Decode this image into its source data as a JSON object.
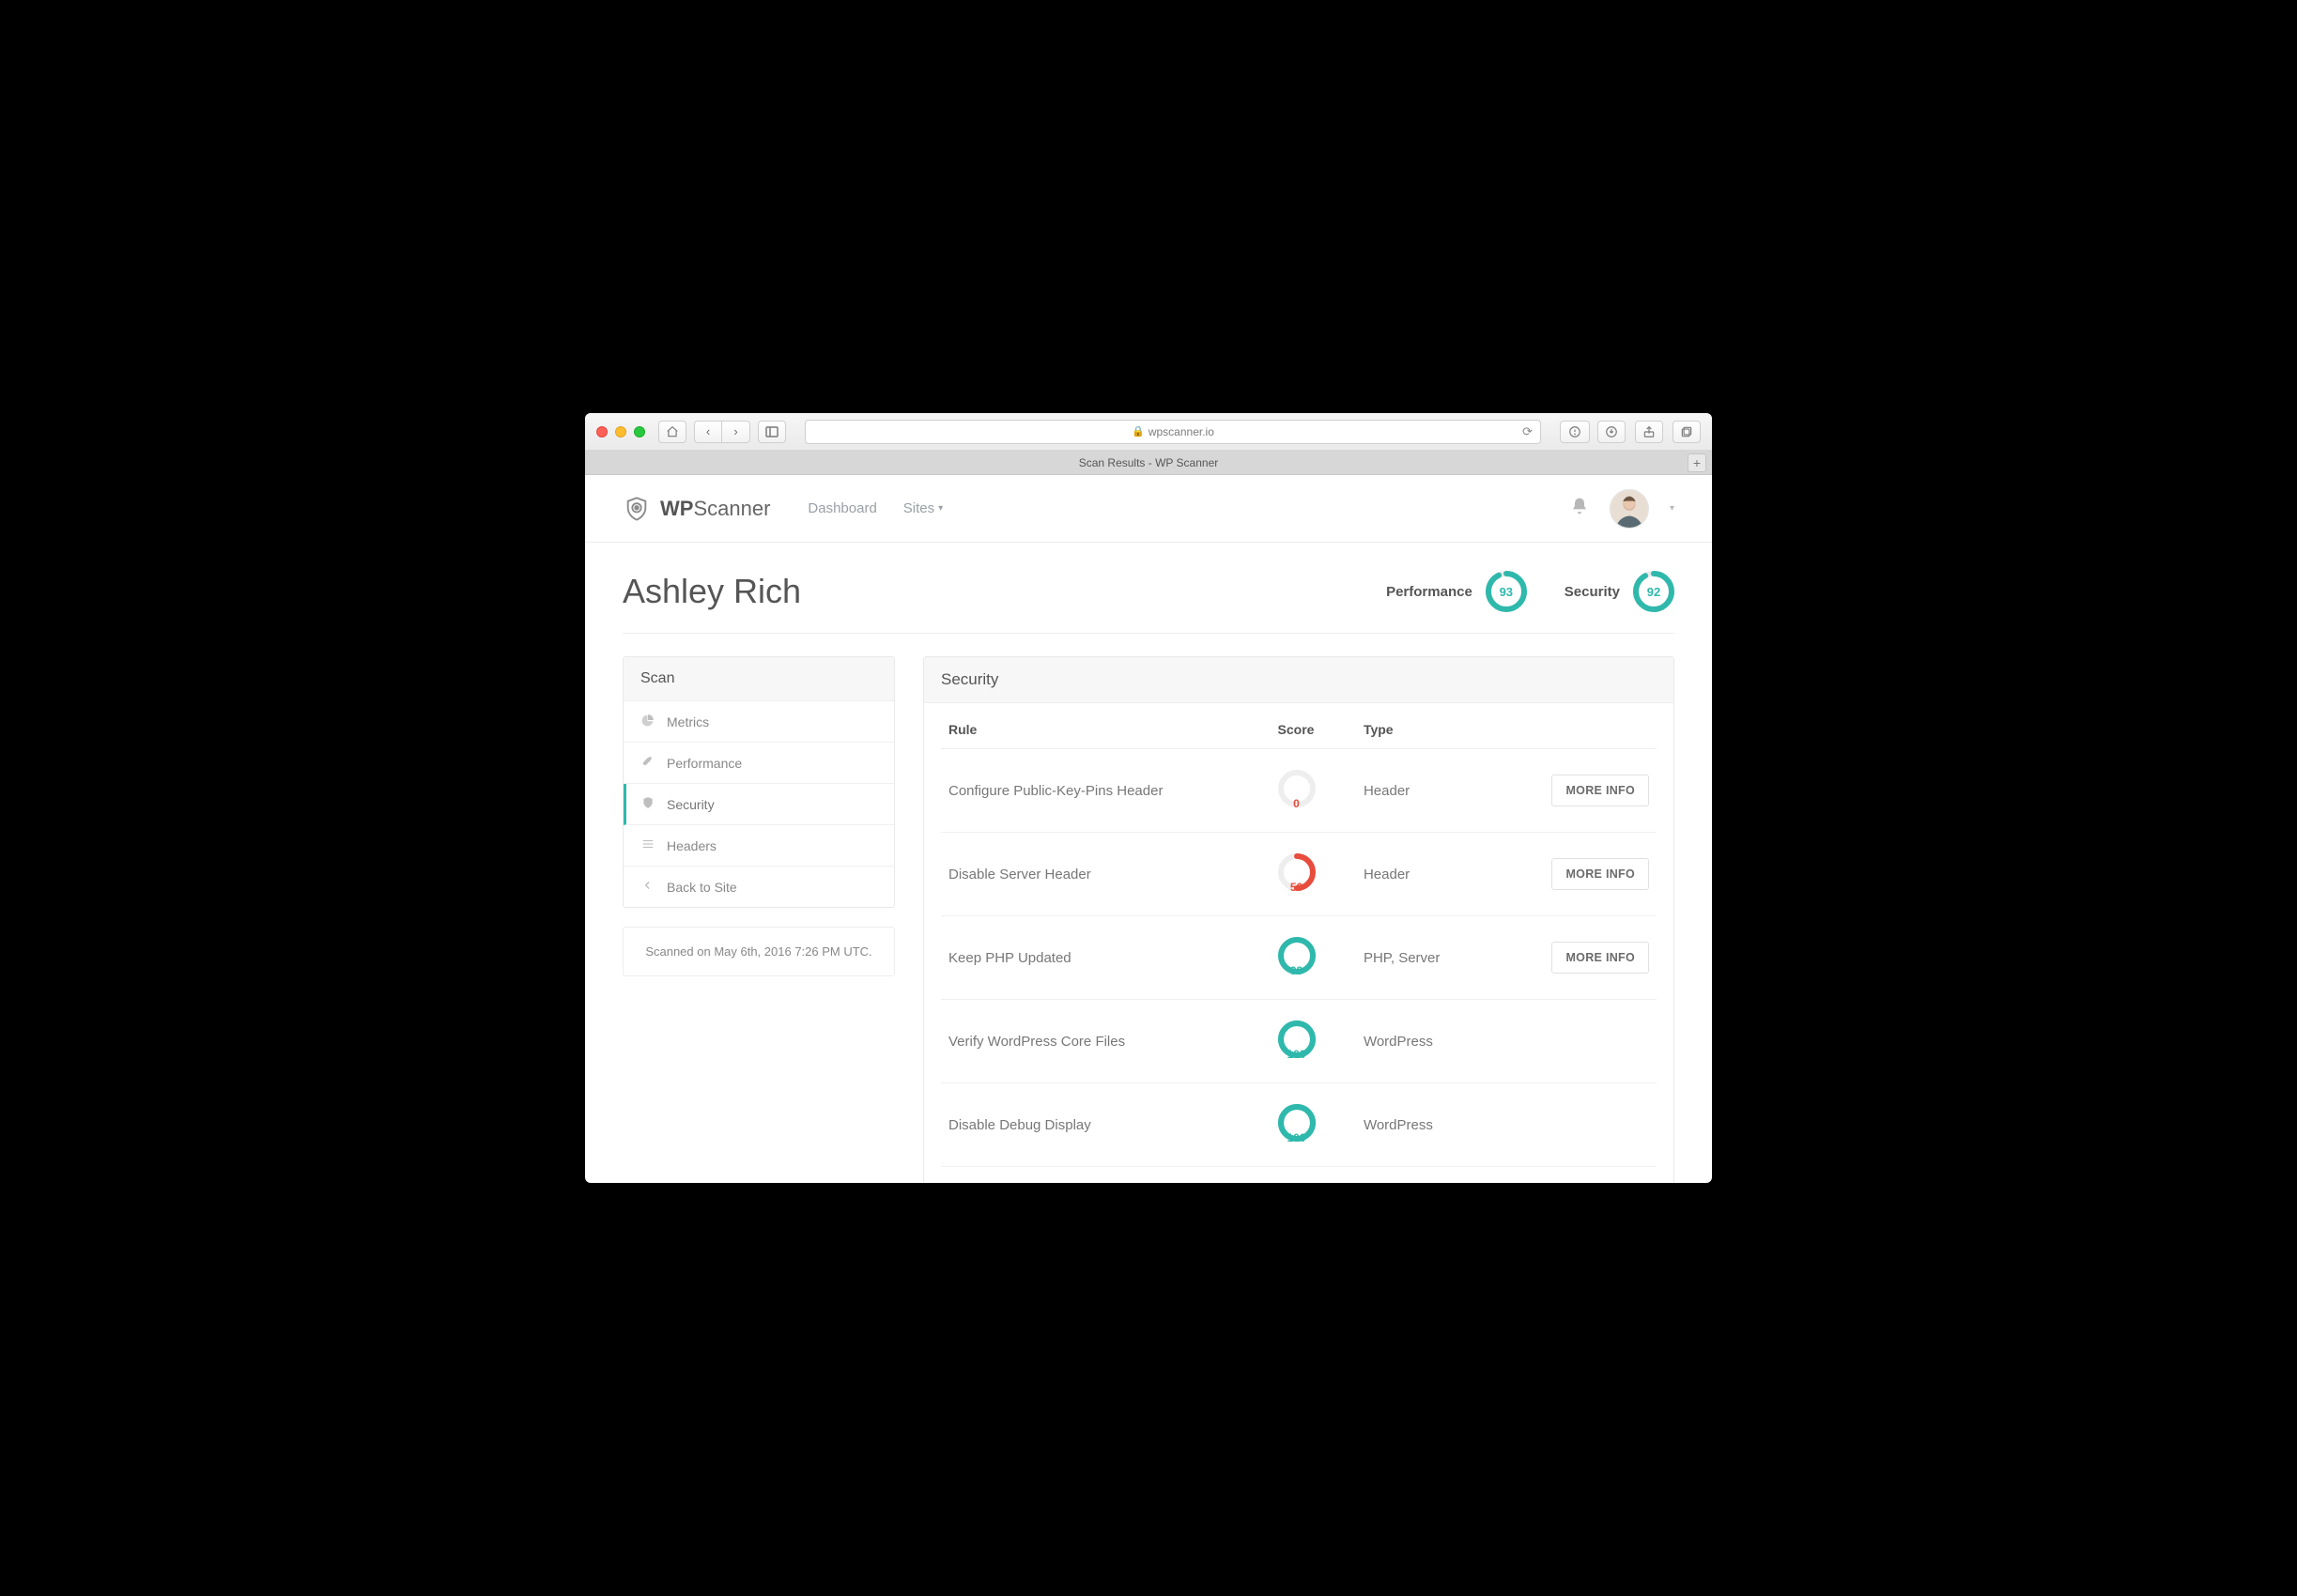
{
  "browser": {
    "url_host": "wpscanner.io",
    "tab_title": "Scan Results - WP Scanner"
  },
  "brand": {
    "bold": "WP",
    "light": "Scanner"
  },
  "nav": {
    "dashboard": "Dashboard",
    "sites": "Sites"
  },
  "page": {
    "site_name": "Ashley Rich",
    "scores": {
      "performance": {
        "label": "Performance",
        "value": 93,
        "color": "#2fb8ac"
      },
      "security": {
        "label": "Security",
        "value": 92,
        "color": "#2fb8ac"
      }
    }
  },
  "sidebar": {
    "heading": "Scan",
    "items": [
      {
        "icon": "pie",
        "label": "Metrics",
        "active": false
      },
      {
        "icon": "rocket",
        "label": "Performance",
        "active": false
      },
      {
        "icon": "shield",
        "label": "Security",
        "active": true
      },
      {
        "icon": "list",
        "label": "Headers",
        "active": false
      },
      {
        "icon": "back",
        "label": "Back to Site",
        "active": false
      }
    ],
    "scanned_on": "Scanned on May 6th, 2016 7:26 PM UTC."
  },
  "content": {
    "heading": "Security",
    "columns": {
      "rule": "Rule",
      "score": "Score",
      "type": "Type"
    },
    "more_info_label": "MORE INFO",
    "rows": [
      {
        "rule": "Configure Public-Key-Pins Header",
        "score": 0,
        "color": "#e74c3c",
        "track": "#eeeeee",
        "type": "Header",
        "more": true
      },
      {
        "rule": "Disable Server Header",
        "score": 50,
        "color": "#e74c3c",
        "track": "#eeeeee",
        "type": "Header",
        "more": true
      },
      {
        "rule": "Keep PHP Updated",
        "score": 98,
        "color": "#2fb8ac",
        "track": "#d9f1ee",
        "type": "PHP, Server",
        "more": true
      },
      {
        "rule": "Verify WordPress Core Files",
        "score": 100,
        "color": "#2fb8ac",
        "track": "#2fb8ac",
        "type": "WordPress",
        "more": false
      },
      {
        "rule": "Disable Debug Display",
        "score": 100,
        "color": "#2fb8ac",
        "track": "#2fb8ac",
        "type": "WordPress",
        "more": false
      }
    ]
  }
}
